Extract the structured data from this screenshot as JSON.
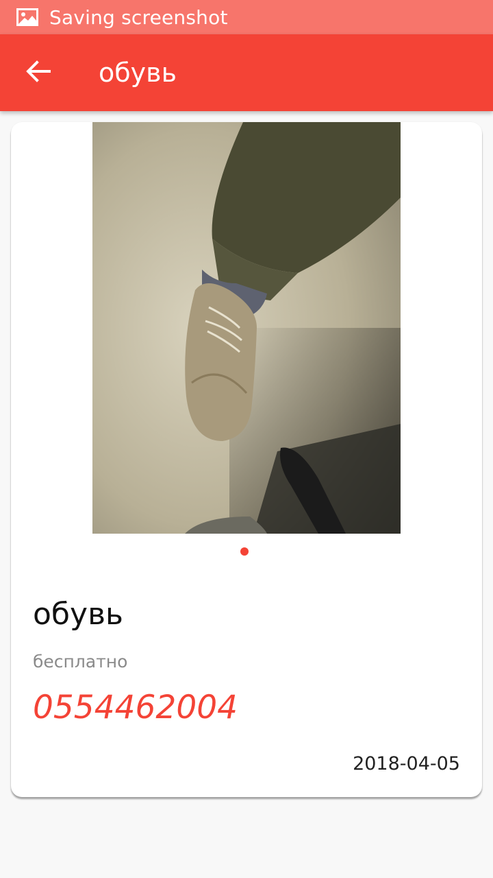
{
  "status_bar": {
    "icon": "image-icon",
    "text": "Saving screenshot",
    "background": "#f7756b"
  },
  "app_bar": {
    "back_icon": "arrow-back-icon",
    "title": "обувь",
    "background": "#f44336"
  },
  "listing": {
    "photo": "shoe-photo",
    "pages": 1,
    "current_page": 1,
    "title": "обувь",
    "price": "бесплатно",
    "phone": "0554462004",
    "date": "2018-04-05",
    "accent": "#f44336"
  }
}
